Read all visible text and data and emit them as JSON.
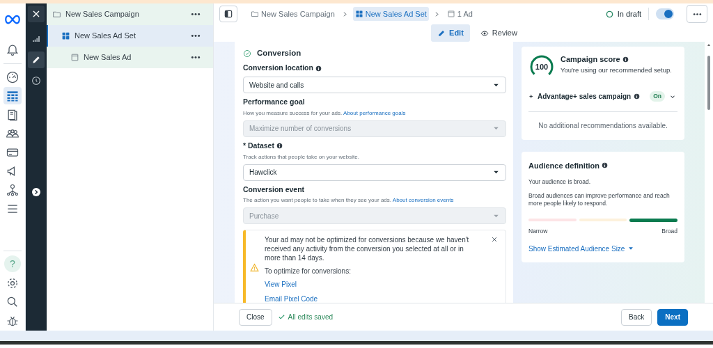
{
  "nav_rail": {
    "top": [
      {
        "kind": "logo",
        "selected": false
      },
      {
        "kind": "bell",
        "selected": false
      }
    ],
    "middle": [
      {
        "kind": "gauge",
        "selected": false
      },
      {
        "kind": "table",
        "selected": true
      },
      {
        "kind": "pages",
        "selected": false
      },
      {
        "kind": "people",
        "selected": false
      },
      {
        "kind": "card",
        "selected": false
      },
      {
        "kind": "megaphone",
        "selected": false
      },
      {
        "kind": "org",
        "selected": false
      },
      {
        "kind": "menu",
        "selected": false
      }
    ],
    "bottom": [
      {
        "kind": "help",
        "label": "?",
        "selected": false
      },
      {
        "kind": "settings",
        "selected": false
      },
      {
        "kind": "search",
        "selected": false
      },
      {
        "kind": "bug",
        "selected": false
      }
    ]
  },
  "tool_rail": {
    "close": {
      "kind": "close"
    },
    "items": [
      {
        "kind": "chart",
        "selected": false
      },
      {
        "kind": "edit",
        "selected": true
      },
      {
        "kind": "history",
        "selected": false
      }
    ],
    "expand": {
      "kind": "chevron"
    }
  },
  "tree": [
    {
      "label": "New Sales Campaign",
      "kind": "campaign",
      "selected": false,
      "children": [
        {
          "label": "New Sales Ad Set",
          "kind": "adset",
          "selected": true,
          "children": [
            {
              "label": "New Sales Ad",
              "kind": "ad",
              "selected": false
            }
          ]
        }
      ]
    }
  ],
  "breadcrumbs": [
    {
      "label": "New Sales Campaign",
      "kind": "campaign",
      "selected": false
    },
    {
      "label": "New Sales Ad Set",
      "kind": "adset",
      "selected": true
    },
    {
      "label": "1 Ad",
      "kind": "ad",
      "selected": false
    }
  ],
  "status": {
    "label": "In draft",
    "on": true
  },
  "tabs": [
    {
      "label": "Edit",
      "kind": "edit",
      "selected": true
    },
    {
      "label": "Review",
      "kind": "review",
      "selected": false
    }
  ],
  "section": {
    "title": "Conversion",
    "complete": true
  },
  "fields": [
    {
      "label": "Conversion location",
      "info": true,
      "value": "Website and calls",
      "disabled": false
    },
    {
      "label": "Performance goal",
      "info": false,
      "help": "How you measure success for your ads.",
      "help_link": "About performance goals",
      "value": "Maximize number of conversions",
      "disabled": true
    },
    {
      "label": "* Dataset",
      "info": true,
      "help": "Track actions that people take on your website.",
      "value": "Hawclick",
      "disabled": false
    },
    {
      "label": "Conversion event",
      "info": false,
      "help": "The action you want people to take when they see your ads.",
      "help_link": "About conversion events",
      "value": "Purchase",
      "disabled": true
    }
  ],
  "alert": {
    "message": "Your ad may not be optimized for conversions because we haven't received any activity from the conversion you selected at all or in more than 14 days.",
    "subtitle": "To optimize for conversions:",
    "links": [
      "View Pixel",
      "Email Pixel Code"
    ]
  },
  "score_card": {
    "score": "100",
    "title": "Campaign score",
    "subtitle": "You're using our recommended setup.",
    "advantage": {
      "label": "Advantage+ sales campaign",
      "badge": "On",
      "expanded": false
    },
    "note": "No additional recommendations available."
  },
  "audience_card": {
    "title": "Audience definition",
    "lines": [
      "Your audience is broad.",
      "Broad audiences can improve performance and reach more people likely to respond."
    ],
    "segments": [
      {
        "color": "#fde4e6",
        "selected": false
      },
      {
        "color": "#fdf1dc",
        "selected": false
      },
      {
        "color": "#0a7b4f",
        "selected": true
      }
    ],
    "low_label": "Narrow",
    "high_label": "Broad",
    "link": "Show Estimated Audience Size"
  },
  "footer": {
    "close": "Close",
    "saved": "All edits saved",
    "back": "Back",
    "next": "Next"
  }
}
